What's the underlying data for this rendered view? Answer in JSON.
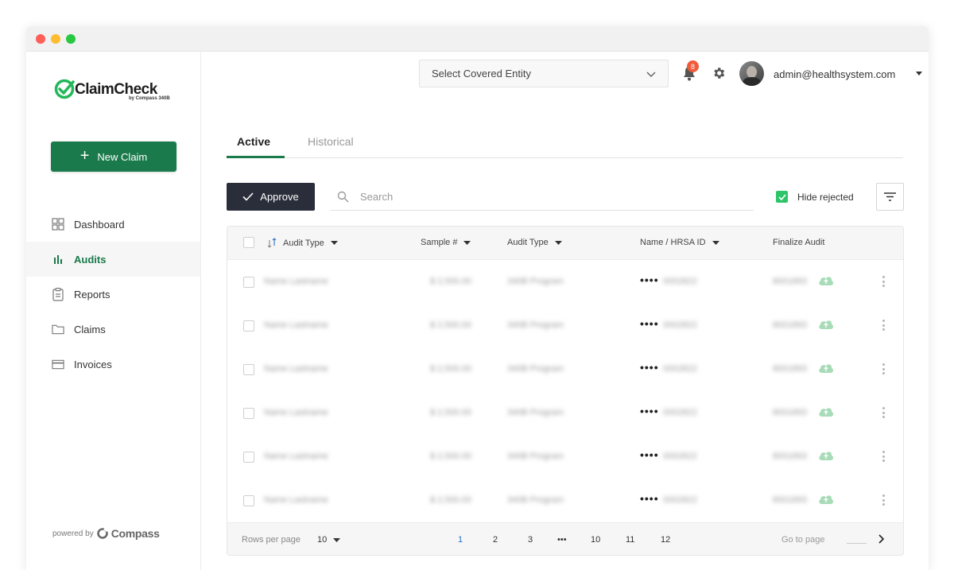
{
  "brand": {
    "name": "ClaimCheck",
    "sub": "by Compass 340B",
    "accent": "#1a7a4c"
  },
  "sidebar": {
    "new_claim": "New Claim",
    "items": [
      {
        "label": "Dashboard",
        "icon": "grid-icon",
        "active": false
      },
      {
        "label": "Audits",
        "icon": "bar-chart-icon",
        "active": true
      },
      {
        "label": "Reports",
        "icon": "clipboard-icon",
        "active": false
      },
      {
        "label": "Claims",
        "icon": "folder-icon",
        "active": false
      },
      {
        "label": "Invoices",
        "icon": "card-icon",
        "active": false
      }
    ],
    "powered_by": "powered by",
    "powered_brand": "Compass"
  },
  "header": {
    "entity_placeholder": "Select Covered Entity",
    "notification_count": "8",
    "user_email": "admin@healthsystem.com"
  },
  "tabs": [
    {
      "label": "Active"
    },
    {
      "label": "Historical"
    }
  ],
  "toolbar": {
    "approve": "Approve",
    "search_placeholder": "Search",
    "hide_rejected": "Hide rejected"
  },
  "table": {
    "columns": [
      "Audit Type",
      "Sample #",
      "Audit Type",
      "Name / HRSA ID",
      "Finalize Audit"
    ],
    "rows": [
      {
        "name": "Name Lastname",
        "amount": "$ 2,500.00",
        "program": "340B Program",
        "mask": "••••",
        "id": "0002822",
        "audit": "8001893"
      },
      {
        "name": "Name Lastname",
        "amount": "$ 2,500.00",
        "program": "340B Program",
        "mask": "••••",
        "id": "0002822",
        "audit": "8001893"
      },
      {
        "name": "Name Lastname",
        "amount": "$ 2,500.00",
        "program": "340B Program",
        "mask": "••••",
        "id": "0002822",
        "audit": "8001893"
      },
      {
        "name": "Name Lastname",
        "amount": "$ 2,500.00",
        "program": "340B Program",
        "mask": "••••",
        "id": "0002822",
        "audit": "8001893"
      },
      {
        "name": "Name Lastname",
        "amount": "$ 2,500.00",
        "program": "340B Program",
        "mask": "••••",
        "id": "0002822",
        "audit": "8001893"
      },
      {
        "name": "Name Lastname",
        "amount": "$ 2,500.00",
        "program": "340B Program",
        "mask": "••••",
        "id": "0002822",
        "audit": "8001893"
      }
    ]
  },
  "pagination": {
    "rows_per_page_label": "Rows per page",
    "rows_per_page": "10",
    "pages": [
      "1",
      "2",
      "3",
      "•••",
      "10",
      "11",
      "12"
    ],
    "current": "1",
    "go_to_label": "Go to page"
  }
}
